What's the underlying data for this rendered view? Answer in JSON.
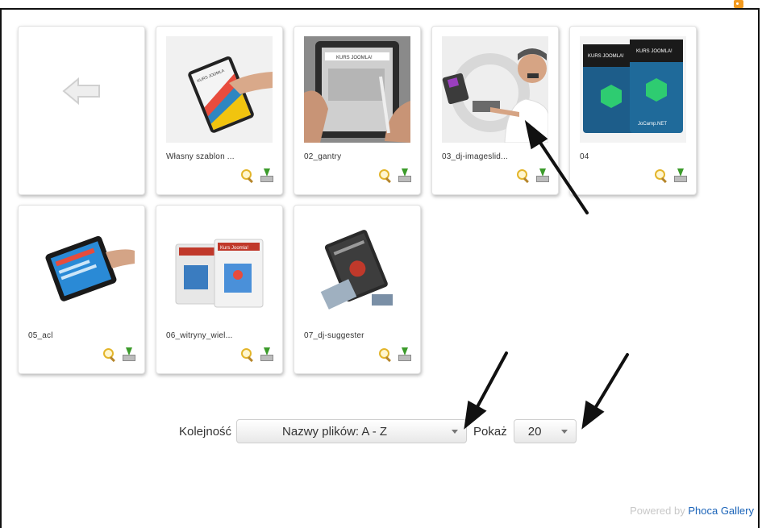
{
  "gallery": {
    "items": [
      {
        "caption": "Własny szablon ..."
      },
      {
        "caption": "02_gantry"
      },
      {
        "caption": "03_dj-imageslid..."
      },
      {
        "caption": "04"
      },
      {
        "caption": "05_acl"
      },
      {
        "caption": "06_witryny_wiel..."
      },
      {
        "caption": "07_dj-suggester"
      }
    ],
    "thumb_texts": {
      "i1": "KURS JOOMLA",
      "i2": "KURS JOOMLA!",
      "i4a": "KURS JOOMLA!",
      "i4b": "KURS JOOMLA!",
      "i4c": "JoCamp.NET",
      "i6": "Kurs Joomla!"
    },
    "icon_names": [
      "magnifier-icon",
      "download-icon",
      "back-arrow-icon",
      "rss-icon"
    ]
  },
  "controls": {
    "order_label": "Kolejność",
    "order_value": "Nazwy plików: A - Z",
    "show_label": "Pokaż",
    "show_value": "20"
  },
  "footer": {
    "powered_by": "Powered by",
    "brand": "Phoca Gallery"
  },
  "colors": {
    "link": "#1a63b8",
    "footer_text": "#c8c8c8",
    "magnifier": "#e3b52a",
    "download_arrow": "#3c9b2b"
  }
}
